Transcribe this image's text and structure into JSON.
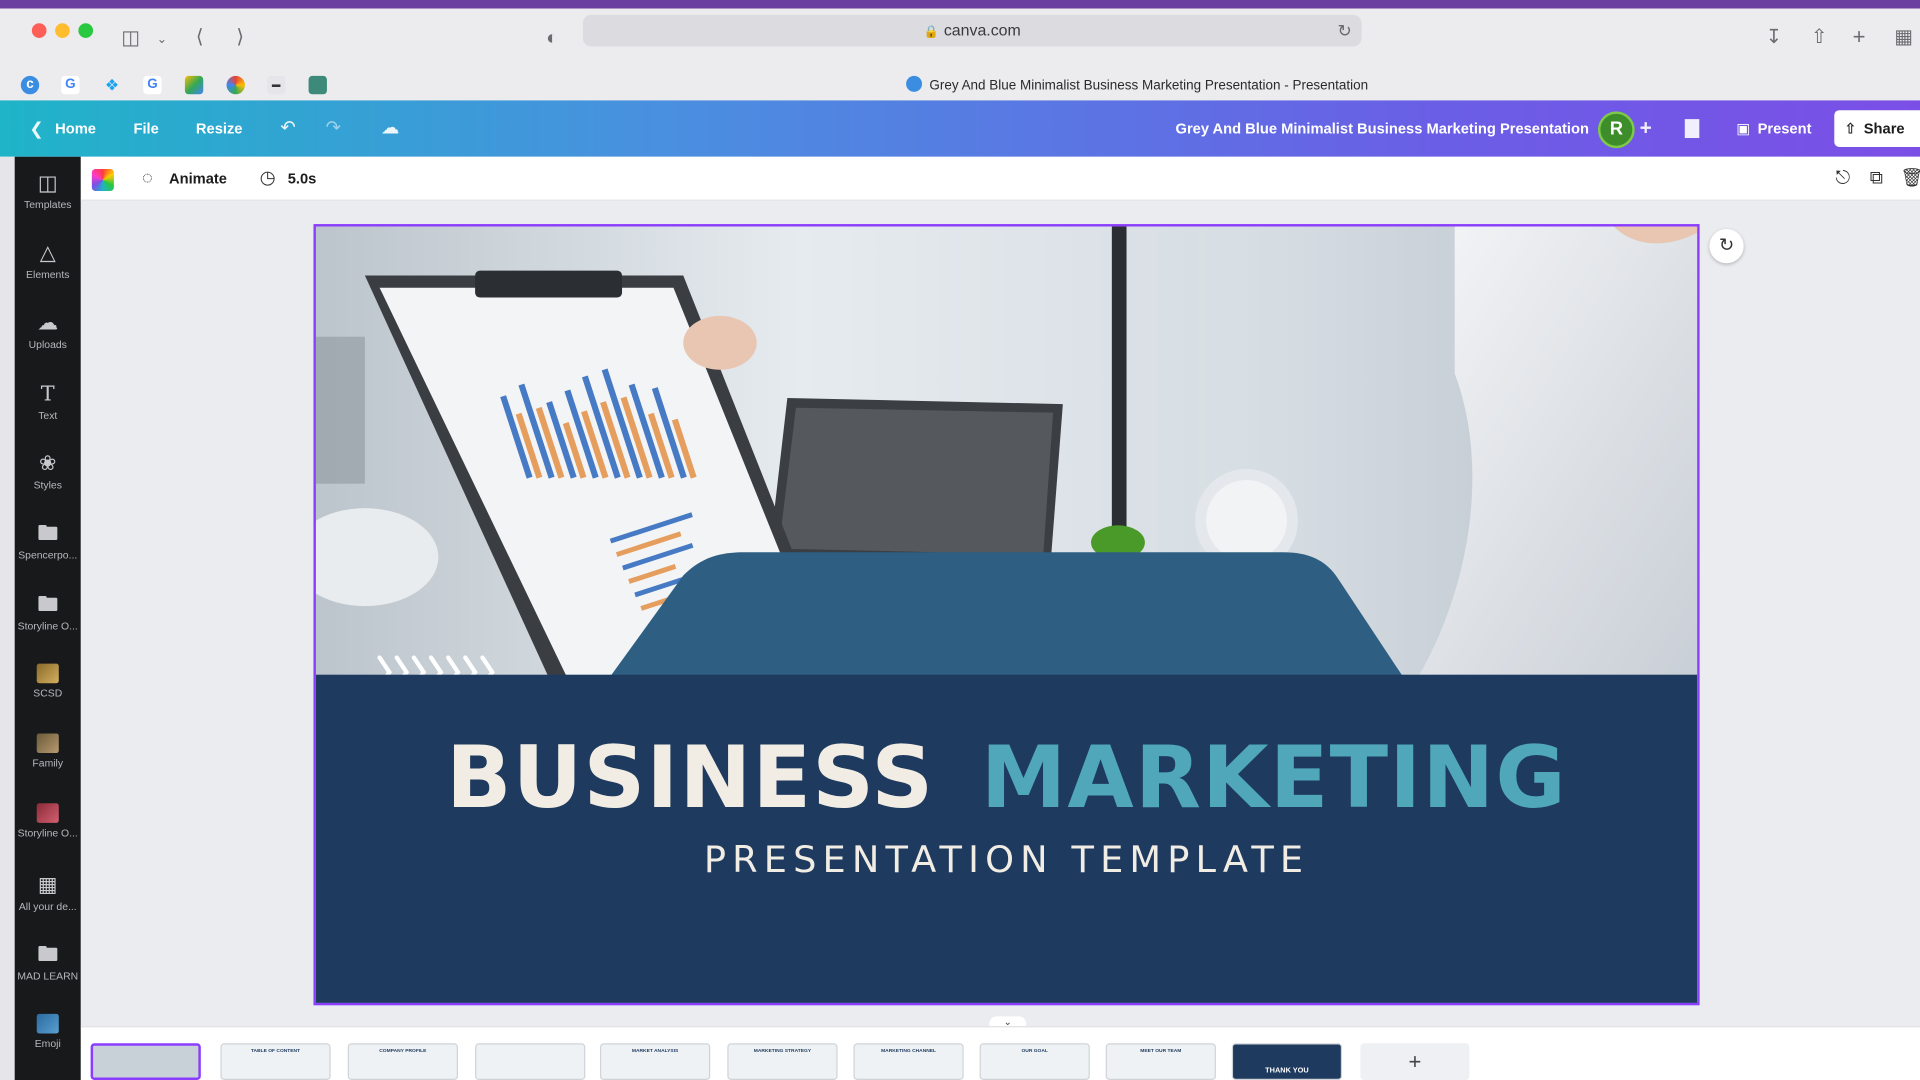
{
  "browser": {
    "url": "canva.com",
    "tab_title": "Grey And Blue Minimalist Business Marketing Presentation - Presentation"
  },
  "header": {
    "home": "Home",
    "file": "File",
    "resize": "Resize",
    "doc_title": "Grey And Blue Minimalist  Business Marketing Presentation",
    "avatar_initial": "R",
    "present": "Present",
    "share": "Share"
  },
  "sidebar": {
    "items": [
      {
        "label": "Templates",
        "icon": "templates-icon"
      },
      {
        "label": "Elements",
        "icon": "elements-icon"
      },
      {
        "label": "Uploads",
        "icon": "uploads-icon"
      },
      {
        "label": "Text",
        "icon": "text-icon"
      },
      {
        "label": "Styles",
        "icon": "styles-icon"
      },
      {
        "label": "Spencerpo...",
        "icon": "folder-icon"
      },
      {
        "label": "Storyline O...",
        "icon": "folder-icon"
      },
      {
        "label": "SCSD",
        "icon": "scsd-thumb"
      },
      {
        "label": "Family",
        "icon": "family-thumb"
      },
      {
        "label": "Storyline O...",
        "icon": "storyline-thumb"
      },
      {
        "label": "All your de...",
        "icon": "grid-icon"
      },
      {
        "label": "MAD LEARN",
        "icon": "folder-icon"
      },
      {
        "label": "Emoji",
        "icon": "emoji-thumb"
      }
    ]
  },
  "editor_toolbar": {
    "animate": "Animate",
    "duration": "5.0s"
  },
  "slide": {
    "title_word1": "BUSINESS",
    "title_word2": "MARKETING",
    "subtitle": "PRESENTATION TEMPLATE",
    "accent_color": "#4fa7b9",
    "band_color": "#1f3a5f"
  },
  "filmstrip": {
    "pages": [
      {
        "label": ""
      },
      {
        "label": "TABLE OF CONTENT"
      },
      {
        "label": "COMPANY PROFILE"
      },
      {
        "label": ""
      },
      {
        "label": "MARKET ANALYSIS"
      },
      {
        "label": "MARKETING STRATEGY"
      },
      {
        "label": "MARKETING CHANNEL"
      },
      {
        "label": "OUR GOAL"
      },
      {
        "label": "MEET OUR TEAM"
      },
      {
        "label": "THANK YOU"
      }
    ],
    "add_label": "+"
  }
}
